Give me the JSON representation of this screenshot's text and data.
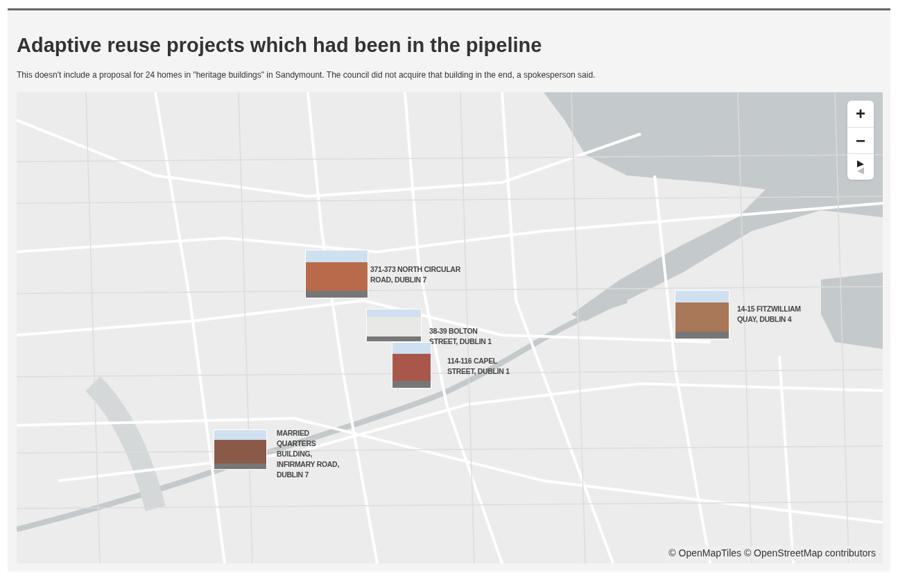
{
  "title": "Adaptive reuse projects which had been in the pipeline",
  "subtitle": "This doesn't include a proposal for 24 homes in \"heritage buildings\" in Sandymount. The council did not acquire that building in the end, a spokesperson said.",
  "map": {
    "controls": [
      {
        "kind": "zoom-in",
        "label": "+"
      },
      {
        "kind": "zoom-out",
        "label": "−"
      },
      {
        "kind": "compass"
      }
    ],
    "markers": [
      {
        "label": "371-373 NORTH CIRCULAR ROAD, DUBLIN 7"
      },
      {
        "label": "38-39 BOLTON STREET, DUBLIN 1"
      },
      {
        "label": "114-116 CAPEL STREET, DUBLIN 1"
      },
      {
        "label": "14-15 FITZWILLIAM QUAY, DUBLIN 4"
      },
      {
        "label": "MARRIED QUARTERS BUILDING, INFIRMARY ROAD, DUBLIN 7"
      }
    ],
    "attribution": "© OpenMapTiles © OpenStreetMap contributors"
  }
}
